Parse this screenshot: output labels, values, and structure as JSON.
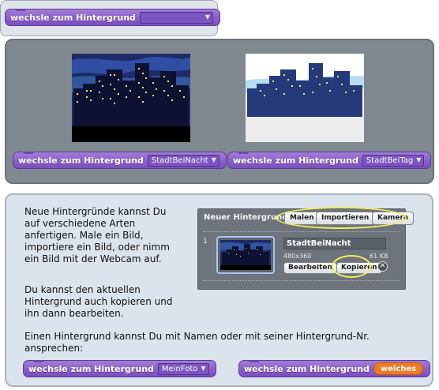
{
  "top_block": {
    "label": "wechsle zum Hintergrund",
    "value": ""
  },
  "examples": [
    {
      "label": "wechsle zum Hintergrund",
      "value": "StadtBeiNacht",
      "scene": "night"
    },
    {
      "label": "wechsle zum Hintergrund",
      "value": "StadtBeiTag",
      "scene": "day"
    }
  ],
  "text": {
    "p1": "Neue Hintergründe kannst Du auf  verschiedene Arten anfertigen. Male ein Bild, importiere ein Bild, oder nimm ein Bild mit der Webcam auf.",
    "p2": "Du kannst den aktuellen Hintergrund auch kopieren und ihn dann bearbeiten.",
    "p3": "Einen Hintergrund kannst Du mit Namen oder mit seiner Hintergrund-Nr. ansprechen:"
  },
  "costume_panel": {
    "header": "Neuer Hintergrund:",
    "buttons": [
      "Malen",
      "Importieren",
      "Kamera"
    ],
    "item_index": "1",
    "item_name": "StadtBeiNacht",
    "dimensions": "480x360",
    "size": "61 KB",
    "edit_label": "Bearbeiten",
    "copy_label": "Kopieren",
    "delete_symbol": "✕"
  },
  "bottom_blocks": [
    {
      "label": "wechsle zum Hintergrund",
      "value": "MeinFoto"
    },
    {
      "label": "wechsle zum Hintergrund",
      "value": "welches"
    }
  ],
  "colors": {
    "looks_block": "#8a5fcb",
    "highlight": "#f4ec5a",
    "reporter": "#f07b1f"
  }
}
